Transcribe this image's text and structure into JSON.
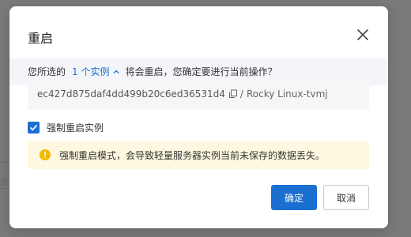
{
  "background": {
    "partial_text": "网"
  },
  "dialog": {
    "title": "重启",
    "summary_prefix": "您所选的",
    "instance_count_link": "1 个实例",
    "summary_suffix": "将会重启，您确定要进行当前操作？",
    "instance_id": "ec427d875daf4dd499b20c6ed36531d4",
    "separator": "/",
    "instance_name": "Rocky Linux-tvmj",
    "force_restart_label": "强制重启实例",
    "force_restart_checked": true,
    "warning_text": "强制重启模式，会导致轻量服务器实例当前未保存的数据丢失。",
    "confirm_label": "确定",
    "cancel_label": "取消"
  },
  "colors": {
    "primary": "#1a6fd0",
    "warning_bg": "#fff8e0",
    "warning_icon": "#f5b800"
  }
}
